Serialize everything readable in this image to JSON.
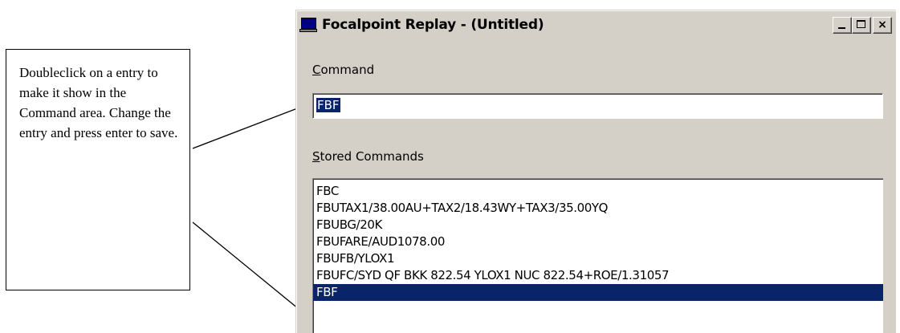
{
  "callout": {
    "text": "Doubleclick on a entry to make it show in the Command area. Change the entry and press enter to save."
  },
  "window": {
    "title": "Focalpoint Replay - (Untitled)",
    "icon": "computer-monitor-icon",
    "buttons": {
      "minimize": "minimize",
      "maximize": "maximize",
      "close": "×"
    }
  },
  "command": {
    "label_accel": "C",
    "label_rest": "ommand",
    "value": "FBF"
  },
  "stored_commands": {
    "label_accel": "S",
    "label_rest": "tored Commands",
    "items": [
      {
        "text": "FBC",
        "selected": false
      },
      {
        "text": "FBUTAX1/38.00AU+TAX2/18.43WY+TAX3/35.00YQ",
        "selected": false
      },
      {
        "text": "FBUBG/20K",
        "selected": false
      },
      {
        "text": "FBUFARE/AUD1078.00",
        "selected": false
      },
      {
        "text": "FBUFB/YLOX1",
        "selected": false
      },
      {
        "text": "FBUFC/SYD QF BKK 822.54 YLOX1 NUC 822.54+ROE/1.31057",
        "selected": false
      },
      {
        "text": "FBF",
        "selected": true
      }
    ]
  },
  "colors": {
    "selection": "#0a246a",
    "window_face": "#d4d0c8"
  }
}
